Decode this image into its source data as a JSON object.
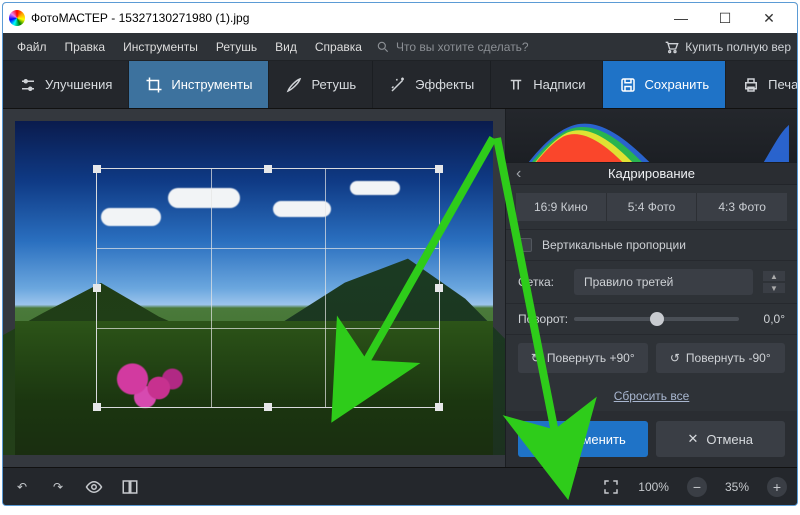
{
  "window": {
    "app_name": "ФотоМАСТЕР",
    "file_name": "15327130271980 (1).jpg"
  },
  "menu": {
    "file": "Файл",
    "edit": "Правка",
    "tools": "Инструменты",
    "retouch": "Ретушь",
    "view": "Вид",
    "help": "Справка",
    "search_placeholder": "Что вы хотите сделать?",
    "buy": "Купить полную вер"
  },
  "tabs": {
    "enhance": "Улучшения",
    "tools": "Инструменты",
    "retouch": "Ретушь",
    "effects": "Эффекты",
    "captions": "Надписи",
    "save": "Сохранить",
    "print": "Печать"
  },
  "panel": {
    "title": "Кадрирование",
    "ratios": {
      "r169": "16:9 Кино",
      "r54": "5:4 Фото",
      "r43": "4:3 Фото"
    },
    "vertical_label": "Вертикальные пропорции",
    "grid_label": "Сетка:",
    "grid_value": "Правило третей",
    "rotate_label": "Поворот:",
    "rotate_value": "0,0°",
    "rot_plus": "Повернуть +90°",
    "rot_minus": "Повернуть -90°",
    "reset": "Сбросить все",
    "apply": "Применить",
    "cancel": "Отмена"
  },
  "bottom": {
    "zoom_fit": "100%",
    "zoom_level": "35%"
  }
}
